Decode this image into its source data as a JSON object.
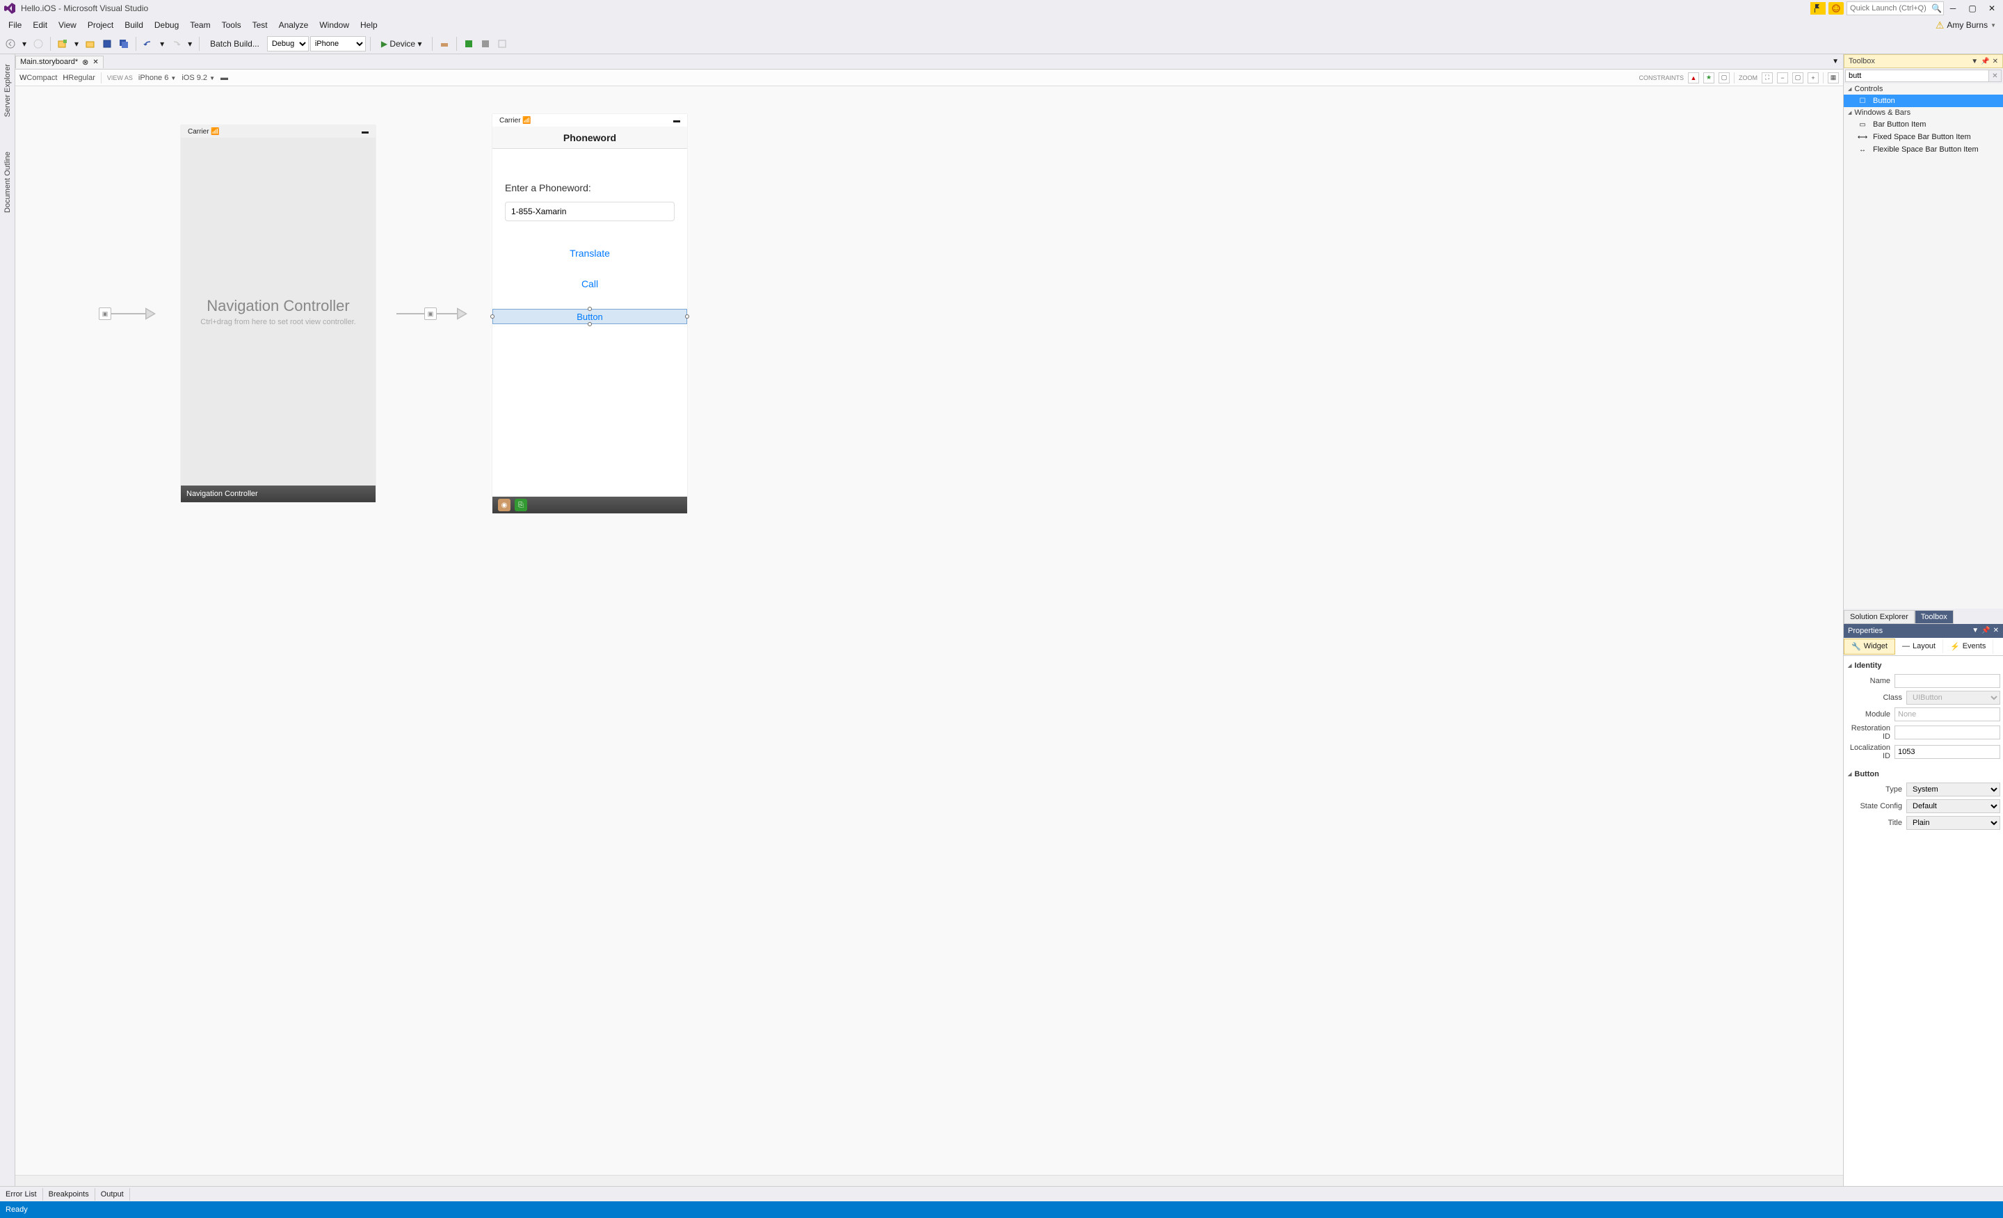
{
  "titlebar": {
    "title": "Hello.iOS - Microsoft Visual Studio",
    "quick_launch_placeholder": "Quick Launch (Ctrl+Q)"
  },
  "menubar": {
    "items": [
      "File",
      "Edit",
      "View",
      "Project",
      "Build",
      "Debug",
      "Team",
      "Tools",
      "Test",
      "Analyze",
      "Window",
      "Help"
    ],
    "user": "Amy Burns"
  },
  "toolbar": {
    "batch_build": "Batch Build...",
    "config": "Debug",
    "platform": "iPhone",
    "device": "Device"
  },
  "document_tab": {
    "name": "Main.storyboard*"
  },
  "left_rail": {
    "tabs": [
      "Server Explorer",
      "Document Outline"
    ]
  },
  "designer_bar": {
    "wcompact": "WCompact",
    "hregular": "HRegular",
    "view_as": "VIEW AS",
    "device": "iPhone 6",
    "os": "iOS 9.2",
    "constraints": "CONSTRAINTS",
    "zoom": "ZOOM"
  },
  "storyboard": {
    "nav_scene": {
      "carrier": "Carrier",
      "title": "Navigation Controller",
      "subtitle": "Ctrl+drag from here to set root view controller.",
      "footer": "Navigation Controller"
    },
    "phone_scene": {
      "carrier": "Carrier",
      "nav_title": "Phoneword",
      "label": "Enter a Phoneword:",
      "textfield": "1-855-Xamarin",
      "btn_translate": "Translate",
      "btn_call": "Call",
      "btn_new": "Button"
    }
  },
  "right": {
    "toolbox": {
      "title": "Toolbox",
      "search": "butt",
      "groups": {
        "controls": "Controls",
        "windows_bars": "Windows & Bars"
      },
      "items": {
        "button": "Button",
        "bar_button": "Bar Button Item",
        "fixed_space": "Fixed Space Bar Button Item",
        "flex_space": "Flexible Space Bar Button Item"
      }
    },
    "panel_tabs": {
      "solution": "Solution Explorer",
      "toolbox": "Toolbox"
    },
    "properties": {
      "title": "Properties",
      "tabs": {
        "widget": "Widget",
        "layout": "Layout",
        "events": "Events"
      },
      "groups": {
        "identity": "Identity",
        "button": "Button"
      },
      "fields": {
        "name_label": "Name",
        "name": "",
        "class_label": "Class",
        "class": "UIButton",
        "module_label": "Module",
        "module": "None",
        "restoration_label": "Restoration ID",
        "restoration": "",
        "localization_label": "Localization ID",
        "localization": "1053",
        "type_label": "Type",
        "type": "System",
        "stateconfig_label": "State Config",
        "stateconfig": "Default",
        "title_label": "Title",
        "title": "Plain"
      }
    }
  },
  "bottom_tabs": [
    "Error List",
    "Breakpoints",
    "Output"
  ],
  "status": "Ready"
}
